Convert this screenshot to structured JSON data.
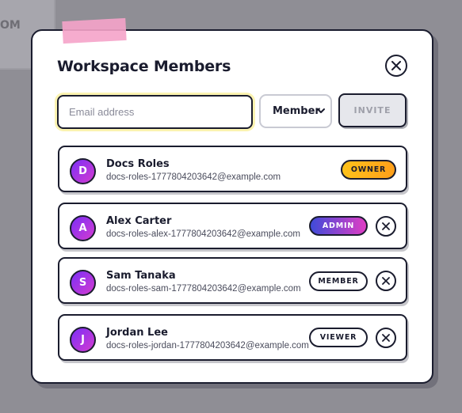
{
  "background": {
    "sidebar_fragment": "OM"
  },
  "modal": {
    "title": "Workspace Members",
    "email_placeholder": "Email address",
    "email_value": "",
    "role_select_value": "Member",
    "invite_label": "INVITE"
  },
  "members": [
    {
      "initial": "D",
      "name": "Docs Roles",
      "email": "docs-roles-1777804203642@example.com",
      "role": "OWNER",
      "removable": false
    },
    {
      "initial": "A",
      "name": "Alex Carter",
      "email": "docs-roles-alex-1777804203642@example.com",
      "role": "ADMIN",
      "removable": true
    },
    {
      "initial": "S",
      "name": "Sam Tanaka",
      "email": "docs-roles-sam-1777804203642@example.com",
      "role": "MEMBER",
      "removable": true
    },
    {
      "initial": "J",
      "name": "Jordan Lee",
      "email": "docs-roles-jordan-1777804203642@example.com",
      "role": "VIEWER",
      "removable": true
    }
  ],
  "icons": {
    "close": "close-icon",
    "remove": "remove-x-icon",
    "select_arrow": "chevron-down-icon"
  },
  "colors": {
    "ink": "#1a1c2e",
    "owner": "#ffb11a",
    "admin_start": "#3f4bd9",
    "admin_end": "#e03dc4",
    "avatar_start": "#7b2ff7",
    "avatar_end": "#d43bd0",
    "tape": "#f5a3c9"
  }
}
